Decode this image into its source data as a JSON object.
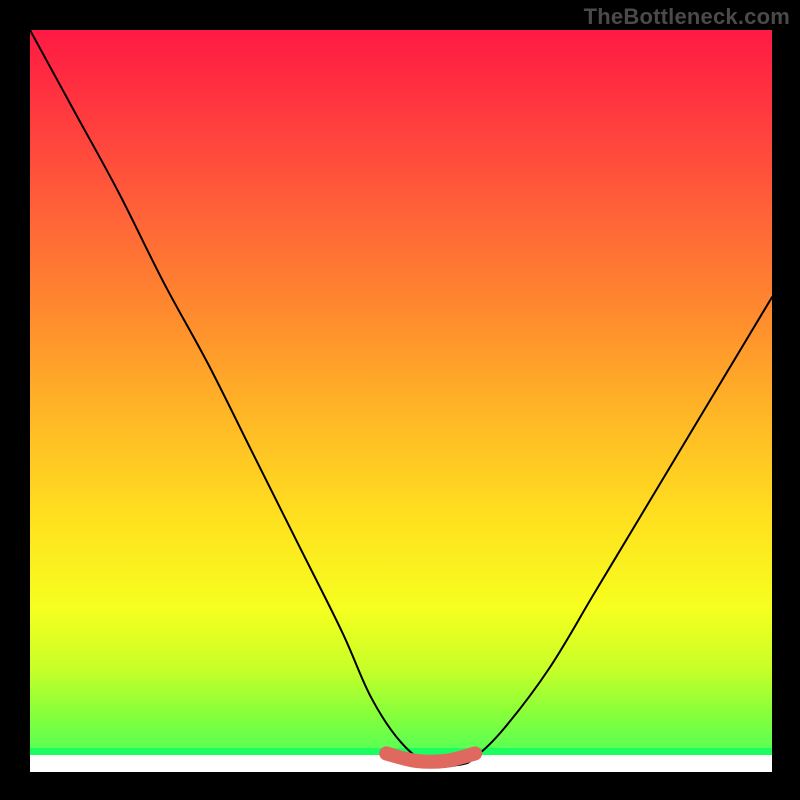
{
  "watermark": "TheBottleneck.com",
  "chart_data": {
    "type": "line",
    "title": "",
    "xlabel": "",
    "ylabel": "",
    "xlim": [
      0,
      100
    ],
    "ylim": [
      0,
      100
    ],
    "grid": false,
    "legend": false,
    "background_gradient": {
      "direction": "vertical",
      "stops": [
        {
          "pos": 0,
          "color": "#ff1a44"
        },
        {
          "pos": 22,
          "color": "#ff5a3a"
        },
        {
          "pos": 52,
          "color": "#ffb726"
        },
        {
          "pos": 78,
          "color": "#f6ff1f"
        },
        {
          "pos": 100,
          "color": "#3cff62"
        }
      ]
    },
    "series": [
      {
        "name": "bottleneck-curve",
        "color": "#000000",
        "stroke_width": 2,
        "x": [
          0,
          6,
          12,
          18,
          24,
          30,
          36,
          42,
          46,
          50,
          54,
          58,
          60,
          64,
          70,
          76,
          82,
          88,
          94,
          100
        ],
        "values": [
          100,
          89,
          78,
          66,
          55,
          43,
          31,
          19,
          10,
          4,
          1,
          1,
          2,
          6,
          14,
          24,
          34,
          44,
          54,
          64
        ]
      },
      {
        "name": "optimal-flat-region",
        "color": "#e0695f",
        "stroke_width": 14,
        "x": [
          48,
          52,
          56,
          60
        ],
        "values": [
          2.5,
          1.5,
          1.5,
          2.5
        ]
      }
    ],
    "bottom_bands": [
      {
        "name": "white-band",
        "y_from": 0,
        "y_to": 2.3,
        "color": "#ffffff"
      },
      {
        "name": "green-strip",
        "y_from": 2.3,
        "y_to": 3.3,
        "color": "#1aff5e"
      }
    ]
  }
}
